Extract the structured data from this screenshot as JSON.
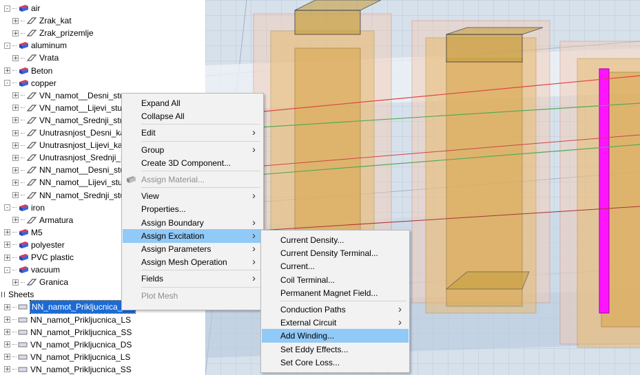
{
  "tree": {
    "rows": [
      {
        "label": "air",
        "kind": "material",
        "expand": "-",
        "indent": 0
      },
      {
        "label": "Zrak_kat",
        "kind": "object",
        "expand": "+",
        "indent": 1
      },
      {
        "label": "Zrak_prizemlje",
        "kind": "object",
        "expand": "+",
        "indent": 1
      },
      {
        "label": "aluminum",
        "kind": "material",
        "expand": "-",
        "indent": 0
      },
      {
        "label": "Vrata",
        "kind": "object",
        "expand": "+",
        "indent": 1
      },
      {
        "label": "Beton",
        "kind": "material",
        "expand": "+",
        "indent": 0
      },
      {
        "label": "copper",
        "kind": "material",
        "expand": "-",
        "indent": 0
      },
      {
        "label": "VN_namot__Desni_stup",
        "kind": "object",
        "expand": "+",
        "indent": 1
      },
      {
        "label": "VN_namot__Lijevi_stup",
        "kind": "object",
        "expand": "+",
        "indent": 1
      },
      {
        "label": "VN_namot_Srednji_stup",
        "kind": "object",
        "expand": "+",
        "indent": 1
      },
      {
        "label": "Unutrasnjost_Desni_kab",
        "kind": "object",
        "expand": "+",
        "indent": 1
      },
      {
        "label": "Unutrasnjost_Lijevi_kab",
        "kind": "object",
        "expand": "+",
        "indent": 1
      },
      {
        "label": "Unutrasnjost_Srednji_ka",
        "kind": "object",
        "expand": "+",
        "indent": 1
      },
      {
        "label": "NN_namot__Desni_stup",
        "kind": "object",
        "expand": "+",
        "indent": 1
      },
      {
        "label": "NN_namot__Lijevi_stup",
        "kind": "object",
        "expand": "+",
        "indent": 1
      },
      {
        "label": "NN_namot_Srednji_stup",
        "kind": "object",
        "expand": "+",
        "indent": 1
      },
      {
        "label": "iron",
        "kind": "material",
        "expand": "-",
        "indent": 0
      },
      {
        "label": "Armatura",
        "kind": "object",
        "expand": "+",
        "indent": 1
      },
      {
        "label": "M5",
        "kind": "material",
        "expand": "+",
        "indent": 0
      },
      {
        "label": "polyester",
        "kind": "material",
        "expand": "+",
        "indent": 0
      },
      {
        "label": "PVC plastic",
        "kind": "material",
        "expand": "+",
        "indent": 0
      },
      {
        "label": "vacuum",
        "kind": "material",
        "expand": "-",
        "indent": 0
      },
      {
        "label": "Granica",
        "kind": "object",
        "expand": "+",
        "indent": 1
      },
      {
        "label": "Sheets",
        "kind": "group",
        "expand": "-",
        "indent": -1
      },
      {
        "label": "NN_namot_Prikljucnica_DS",
        "kind": "sheet",
        "expand": "+",
        "indent": 0,
        "selected": true
      },
      {
        "label": "NN_namot_Prikljucnica_LS",
        "kind": "sheet",
        "expand": "+",
        "indent": 0
      },
      {
        "label": "NN_namot_Prikljucnica_SS",
        "kind": "sheet",
        "expand": "+",
        "indent": 0
      },
      {
        "label": "VN_namot_Prikljucnica_DS",
        "kind": "sheet",
        "expand": "+",
        "indent": 0
      },
      {
        "label": "VN_namot_Prikljucnica_LS",
        "kind": "sheet",
        "expand": "+",
        "indent": 0
      },
      {
        "label": "VN_namot_Prikljucnica_SS",
        "kind": "sheet",
        "expand": "+",
        "indent": 0
      }
    ]
  },
  "context_menu": {
    "items": [
      {
        "label": "Expand All",
        "submenu": false
      },
      {
        "label": "Collapse All",
        "submenu": false
      },
      {
        "sep": true
      },
      {
        "label": "Edit",
        "submenu": true
      },
      {
        "sep": true
      },
      {
        "label": "Group",
        "submenu": true
      },
      {
        "label": "Create 3D Component...",
        "submenu": false
      },
      {
        "sep": true
      },
      {
        "label": "Assign Material...",
        "submenu": false,
        "disabled": true,
        "icon": "material-icon"
      },
      {
        "sep": true
      },
      {
        "label": "View",
        "submenu": true
      },
      {
        "label": "Properties...",
        "submenu": false
      },
      {
        "label": "Assign Boundary",
        "submenu": true
      },
      {
        "label": "Assign Excitation",
        "submenu": true,
        "highlighted": true
      },
      {
        "label": "Assign Parameters",
        "submenu": true
      },
      {
        "label": "Assign Mesh Operation",
        "submenu": true
      },
      {
        "sep": true
      },
      {
        "label": "Fields",
        "submenu": true
      },
      {
        "sep": true
      },
      {
        "label": "Plot Mesh",
        "submenu": false,
        "disabled": true
      }
    ]
  },
  "excitation_submenu": {
    "items": [
      {
        "label": "Current Density...",
        "submenu": false
      },
      {
        "label": "Current Density Terminal...",
        "submenu": false
      },
      {
        "label": "Current...",
        "submenu": false
      },
      {
        "label": "Coil Terminal...",
        "submenu": false
      },
      {
        "label": "Permanent Magnet Field...",
        "submenu": false
      },
      {
        "sep": true
      },
      {
        "label": "Conduction Paths",
        "submenu": true
      },
      {
        "label": "External Circuit",
        "submenu": true
      },
      {
        "label": "Add Winding...",
        "submenu": false,
        "highlighted": true
      },
      {
        "label": "Set Eddy Effects...",
        "submenu": false
      },
      {
        "label": "Set Core Loss...",
        "submenu": false
      }
    ]
  },
  "colors": {
    "selection": "#1b6bd6",
    "menu_highlight": "#91c9f7",
    "viewport_bg": "#d6e1ec",
    "winding_fill": "#e8b96a",
    "coil_outline": "#d97a6a",
    "terminal_magenta": "#ff14ff"
  }
}
